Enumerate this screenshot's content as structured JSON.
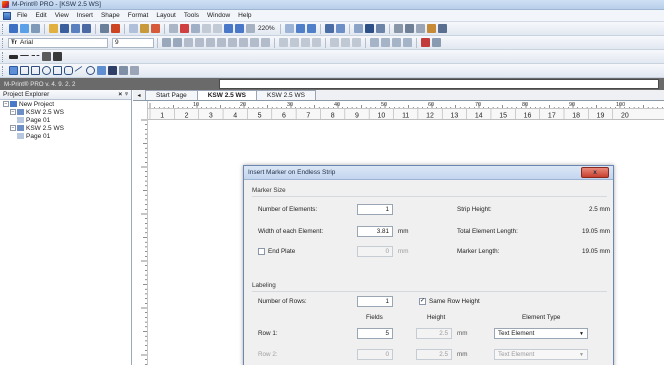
{
  "window": {
    "title": "M-Print® PRO - [KSW 2.5 WS]"
  },
  "menu": {
    "items": [
      {
        "label": "File",
        "key": "F"
      },
      {
        "label": "Edit",
        "key": "E"
      },
      {
        "label": "View",
        "key": "V"
      },
      {
        "label": "Insert",
        "key": "I"
      },
      {
        "label": "Shape",
        "key": "S"
      },
      {
        "label": "Format",
        "key": "o"
      },
      {
        "label": "Layout",
        "key": "L"
      },
      {
        "label": "Tools",
        "key": "T"
      },
      {
        "label": "Window",
        "key": "W"
      },
      {
        "label": "Help",
        "key": "H"
      }
    ]
  },
  "toolbar": {
    "zoom": "220%",
    "font_name": "Arial",
    "font_size": "9"
  },
  "version_bar": {
    "text": "M-Print® PRO v. 4. 9. 2. 2",
    "input_value": ""
  },
  "explorer": {
    "title": "Project Explorer",
    "close": "×",
    "pin": "ᵠ",
    "tree": [
      {
        "label": "New Project",
        "level": 0,
        "expander": "−"
      },
      {
        "label": "KSW 2.5 WS",
        "level": 1,
        "expander": "−"
      },
      {
        "label": "Page 01",
        "level": 2,
        "expander": ""
      },
      {
        "label": "KSW 2.5 WS",
        "level": 1,
        "expander": "−"
      },
      {
        "label": "Page 01",
        "level": 2,
        "expander": ""
      }
    ]
  },
  "tabs": [
    {
      "label": "Start Page",
      "active": false
    },
    {
      "label": "KSW 2.5 WS",
      "active": true
    },
    {
      "label": "KSW 2.5 WS",
      "active": false
    }
  ],
  "ruler": {
    "labels": [
      "10",
      "20",
      "30",
      "40",
      "50",
      "60",
      "70",
      "80",
      "90",
      "100"
    ],
    "columns": [
      "1",
      "2",
      "3",
      "4",
      "5",
      "6",
      "7",
      "8",
      "9",
      "10",
      "11",
      "12",
      "13",
      "14",
      "15",
      "16",
      "17",
      "18",
      "19",
      "20"
    ]
  },
  "dialog": {
    "title": "Insert Marker on Endless Strip",
    "close": "x",
    "marker_size": {
      "section": "Marker Size",
      "num_elements_label": "Number of Elements:",
      "num_elements_value": "1",
      "width_label": "Width of each Element:",
      "width_value": "3.81",
      "width_unit": "mm",
      "end_plate_label": "End Plate",
      "end_plate_value": "0",
      "end_plate_unit": "mm",
      "strip_height_label": "Strip Height:",
      "strip_height_value": "2.5 mm",
      "total_length_label": "Total Element Length:",
      "total_length_value": "19.05 mm",
      "marker_length_label": "Marker Length:",
      "marker_length_value": "19.05 mm"
    },
    "labeling": {
      "section": "Labeling",
      "rows_label": "Number of Rows:",
      "rows_value": "1",
      "same_height_label": "Same Row Height",
      "same_height_checked": true,
      "col_fields": "Fields",
      "col_height": "Height",
      "col_type": "Element Type",
      "rows": [
        {
          "label": "Row 1:",
          "fields": "5",
          "height": "2.5",
          "unit": "mm",
          "type": "Text Element",
          "enabled": true
        },
        {
          "label": "Row 2:",
          "fields": "0",
          "height": "2.5",
          "unit": "mm",
          "type": "Text Element",
          "enabled": false
        }
      ]
    }
  }
}
